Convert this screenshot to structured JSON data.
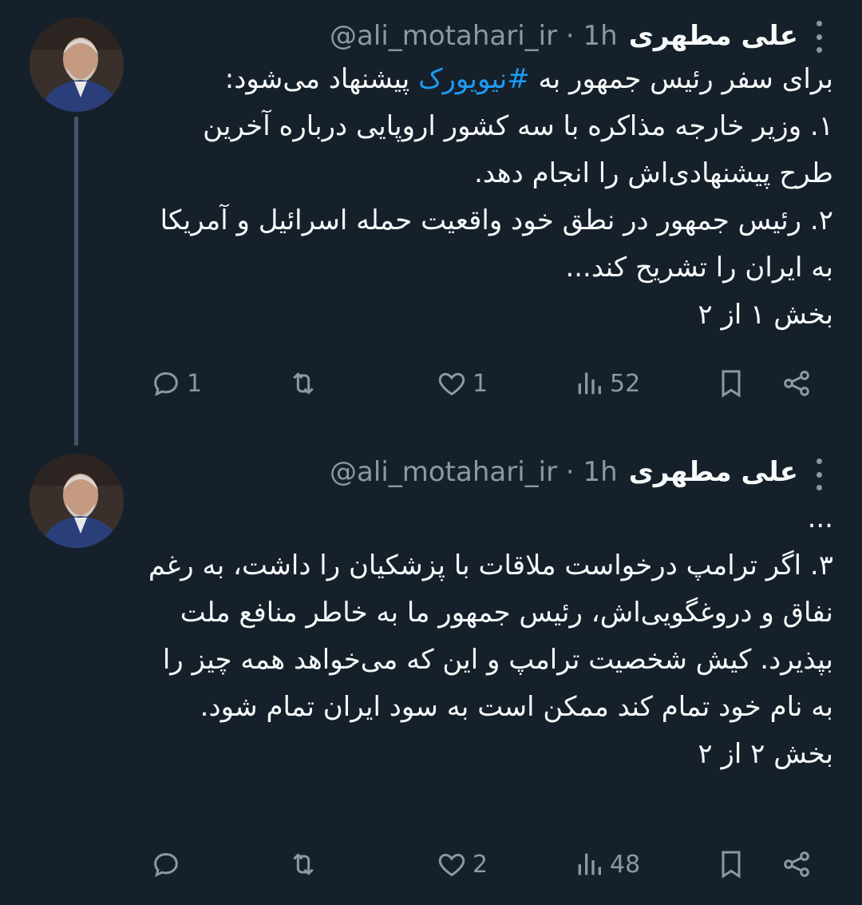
{
  "tweets": [
    {
      "author_name": "علی مطهری",
      "handle": "@ali_motahari_ir",
      "time": "1h",
      "body_before_hashtag": "برای سفر رئیس جمهور به ",
      "hashtag": "#نیویورک",
      "body_after_hashtag": " پیشنهاد می‌شود:\n۱. وزیر خارجه مذاکره با سه کشور اروپایی درباره آخرین طرح پیشنهادی‌اش را انجام دهد.\n۲. رئیس جمهور در نطق خود واقعیت حمله اسرائیل و آمریکا به ایران را تشریح کند...\nبخش ۱ از ۲",
      "replies": "1",
      "retweets": "",
      "likes": "1",
      "views": "52"
    },
    {
      "author_name": "علی مطهری",
      "handle": "@ali_motahari_ir",
      "time": "1h",
      "body": "...\n۳. اگر ترامپ درخواست ملاقات با پزشکیان را داشت، به رغم نفاق و دروغگویی‌اش، رئیس جمهور ما به خاطر منافع ملت بپذیرد. کیش شخصیت ترامپ و این که می‌خواهد همه چیز را به نام خود تمام کند ممکن است به سود ایران تمام شود.\nبخش ۲ از ۲",
      "replies": "",
      "retweets": "",
      "likes": "2",
      "views": "48"
    }
  ],
  "colors": {
    "background": "#15202b",
    "text": "#f7f9f9",
    "secondary": "#8b98a5",
    "link": "#1d9bf0",
    "thread_line": "#425466"
  },
  "icons": [
    "reply-icon",
    "retweet-icon",
    "like-icon",
    "views-icon",
    "bookmark-icon",
    "share-icon",
    "more-icon"
  ]
}
